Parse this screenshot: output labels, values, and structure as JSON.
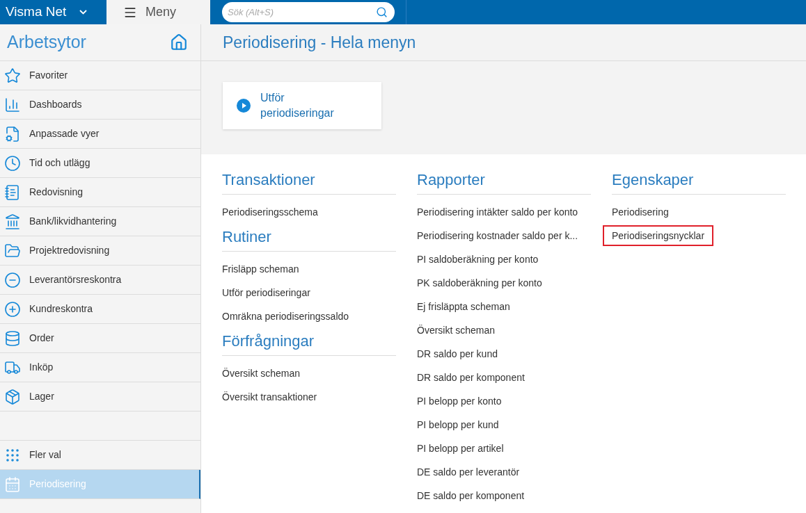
{
  "topbar": {
    "brand": "Visma Net",
    "menu_label": "Meny",
    "search": {
      "placeholder": "Sök (Alt+S)"
    }
  },
  "sidebar": {
    "title": "Arbetsytor",
    "items": [
      {
        "label": "Favoriter",
        "selected": false
      },
      {
        "label": "Dashboards",
        "selected": false
      },
      {
        "label": "Anpassade vyer",
        "selected": false
      },
      {
        "label": "Tid och utlägg",
        "selected": false
      },
      {
        "label": "Redovisning",
        "selected": false
      },
      {
        "label": "Bank/likvidhantering",
        "selected": false
      },
      {
        "label": "Projektredovisning",
        "selected": false
      },
      {
        "label": "Leverantörsreskontra",
        "selected": false
      },
      {
        "label": "Kundreskontra",
        "selected": false
      },
      {
        "label": "Order",
        "selected": false
      },
      {
        "label": "Inköp",
        "selected": false
      },
      {
        "label": "Lager",
        "selected": false
      }
    ],
    "bottom_items": [
      {
        "label": "Fler val",
        "selected": false
      },
      {
        "label": "Periodisering",
        "selected": true
      }
    ]
  },
  "page": {
    "title": "Periodisering - Hela menyn",
    "quick_action": "Utför periodiseringar",
    "columns": [
      {
        "sections": [
          {
            "title": "Transaktioner",
            "links": [
              {
                "label": "Periodiseringsschema",
                "highlighted": false
              }
            ]
          },
          {
            "title": "Rutiner",
            "links": [
              {
                "label": "Frisläpp scheman",
                "highlighted": false
              },
              {
                "label": "Utför periodiseringar",
                "highlighted": false
              },
              {
                "label": "Omräkna periodiseringssaldo",
                "highlighted": false
              }
            ]
          },
          {
            "title": "Förfrågningar",
            "links": [
              {
                "label": "Översikt scheman",
                "highlighted": false
              },
              {
                "label": "Översikt transaktioner",
                "highlighted": false
              }
            ]
          }
        ]
      },
      {
        "sections": [
          {
            "title": "Rapporter",
            "links": [
              {
                "label": "Periodisering intäkter saldo per konto",
                "highlighted": false
              },
              {
                "label": "Periodisering kostnader saldo per k...",
                "highlighted": false
              },
              {
                "label": "PI saldoberäkning per konto",
                "highlighted": false
              },
              {
                "label": "PK saldoberäkning per konto",
                "highlighted": false
              },
              {
                "label": "Ej frisläppta scheman",
                "highlighted": false
              },
              {
                "label": "Översikt scheman",
                "highlighted": false
              },
              {
                "label": "DR saldo per kund",
                "highlighted": false
              },
              {
                "label": "DR saldo per komponent",
                "highlighted": false
              },
              {
                "label": "PI belopp per konto",
                "highlighted": false
              },
              {
                "label": "PI belopp per kund",
                "highlighted": false
              },
              {
                "label": "PI belopp per artikel",
                "highlighted": false
              },
              {
                "label": "DE saldo per leverantör",
                "highlighted": false
              },
              {
                "label": "DE saldo per komponent",
                "highlighted": false
              }
            ]
          }
        ]
      },
      {
        "sections": [
          {
            "title": "Egenskaper",
            "links": [
              {
                "label": "Periodisering",
                "highlighted": false
              },
              {
                "label": "Periodiseringsnycklar",
                "highlighted": true
              }
            ]
          }
        ]
      }
    ]
  }
}
